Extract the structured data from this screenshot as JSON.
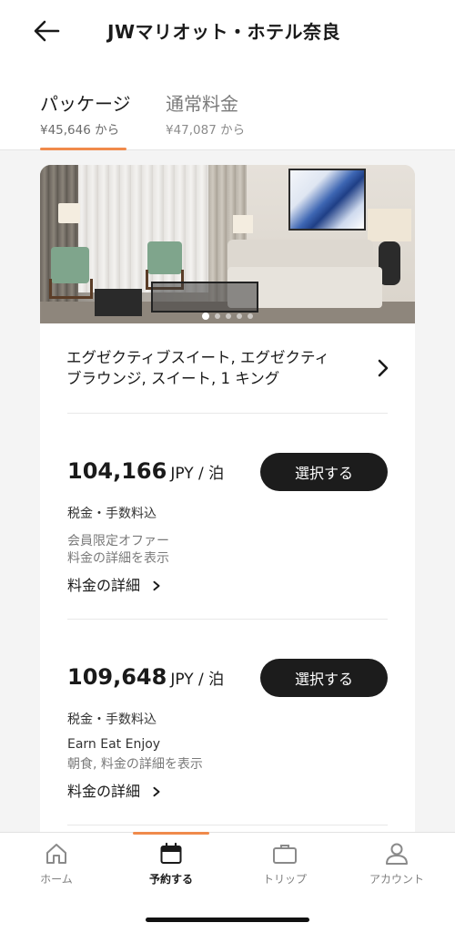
{
  "header": {
    "title": "JWマリオット・ホテル奈良"
  },
  "tabs": [
    {
      "label": "パッケージ",
      "sub": "¥45,646 から"
    },
    {
      "label": "通常料金",
      "sub": "¥47,087 から"
    }
  ],
  "room": {
    "name": "エグゼクティブスイート, エグゼクティブラウンジ, スイート, 1 キング",
    "image_count": 5,
    "active_image": 1
  },
  "rates": [
    {
      "amount": "104,166",
      "unit": "JPY / 泊",
      "button": "選択する",
      "tax": "税金・手数料込",
      "offer_title": "会員限定オファー",
      "offer_detail": "料金の詳細を表示",
      "details_link": "料金の詳細"
    },
    {
      "amount": "109,648",
      "unit": "JPY / 泊",
      "button": "選択する",
      "tax": "税金・手数料込",
      "offer_title": "Earn Eat Enjoy",
      "offer_detail": "朝食, 料金の詳細を表示",
      "details_link": "料金の詳細"
    }
  ],
  "nav": [
    {
      "label": "ホーム",
      "icon": "home-icon"
    },
    {
      "label": "予約する",
      "icon": "calendar-icon"
    },
    {
      "label": "トリップ",
      "icon": "briefcase-icon"
    },
    {
      "label": "アカウント",
      "icon": "account-icon"
    }
  ],
  "colors": {
    "accent": "#f08a4b",
    "button": "#1c1c1c",
    "background": "#f4f4f4"
  }
}
